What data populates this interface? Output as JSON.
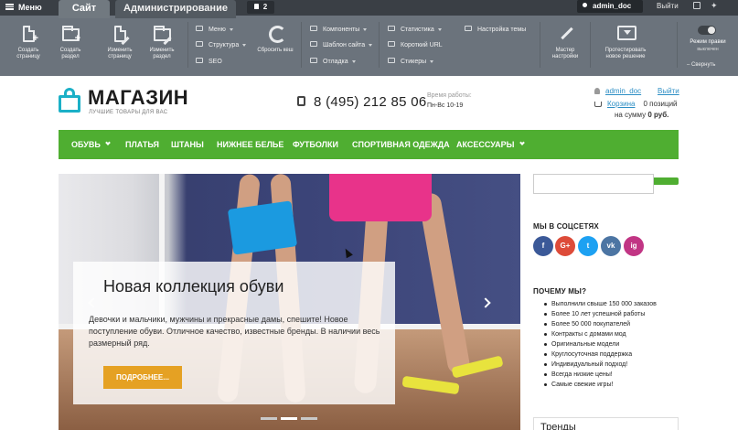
{
  "admin": {
    "menu_label": "Меню",
    "tab_site": "Сайт",
    "tab_admin": "Администрирование",
    "notifications_count": "2",
    "user": "admin_doc",
    "logout": "Выйти",
    "tools": {
      "create_page": "Создать страницу",
      "create_section": "Создать раздел",
      "edit_page": "Изменить страницу",
      "edit_section": "Изменить раздел",
      "reset_cache": "Сбросить кеш",
      "setup_wizard": "Мастер настройки",
      "test_solution": "Протестировать новое решение"
    },
    "menu_items": {
      "menu": "Меню",
      "structure": "Структура",
      "seo": "SEO",
      "components": "Компоненты",
      "site_template": "Шаблон сайта",
      "debug": "Отладка",
      "statistics": "Статистика",
      "short_url": "Короткий URL",
      "stickers": "Стикеры",
      "theme_settings": "Настройка темы"
    },
    "edit_mode": "Режим правки",
    "edit_mode_state": "выключен",
    "collapse": "Свернуть"
  },
  "header": {
    "logo_title": "МАГАЗИН",
    "logo_subtitle": "ЛУЧШИЕ ТОВАРЫ ДЛЯ ВАС",
    "phone": "8 (495) 212 85 06",
    "hours_label": "Время работы:",
    "hours_value": "Пн-Вс 10-19",
    "user_link": "admin_doc",
    "exit_link": "Выйти",
    "cart_link": "Корзина",
    "cart_items": "0 позиций",
    "cart_sum_prefix": "на сумму",
    "cart_sum_value": "0 руб."
  },
  "nav": [
    {
      "label": "ОБУВЬ"
    },
    {
      "label": "ПЛАТЬЯ"
    },
    {
      "label": "ШТАНЫ"
    },
    {
      "label": "НИЖНЕЕ БЕЛЬЕ"
    },
    {
      "label": "ФУТБОЛКИ"
    },
    {
      "label": "СПОРТИВНАЯ ОДЕЖДА"
    },
    {
      "label": "АКСЕССУАРЫ"
    }
  ],
  "hero": {
    "title": "Новая коллекция обуви",
    "text": "Девочки и мальчики, мужчины и прекрасные дамы, спешите! Новое поступление обуви. Отличное качество, известные бренды. В наличии весь размерный ряд.",
    "button": "ПОДРОБНЕЕ..."
  },
  "sidebar": {
    "social_title": "МЫ В СОЦСЕТЯХ",
    "social": [
      {
        "letter": "f",
        "color": "#3b5998"
      },
      {
        "letter": "G+",
        "color": "#dd4b39"
      },
      {
        "letter": "t",
        "color": "#1da1f2"
      },
      {
        "letter": "vk",
        "color": "#4c75a3"
      },
      {
        "letter": "ig",
        "color": "#c13584"
      }
    ],
    "why_title": "ПОЧЕМУ МЫ?",
    "why_items": [
      "Выполнили свыше 150 000 заказов",
      "Более 10 лет успешной работы",
      "Более 50 000 покупателей",
      "Контракты с домами мод",
      "Оригинальные модели",
      "Круглосуточная поддержка",
      "Индивидуальный подход!",
      "Всегда низкие цены!",
      "Самые свежие игры!"
    ],
    "next_title": "Тренды"
  }
}
